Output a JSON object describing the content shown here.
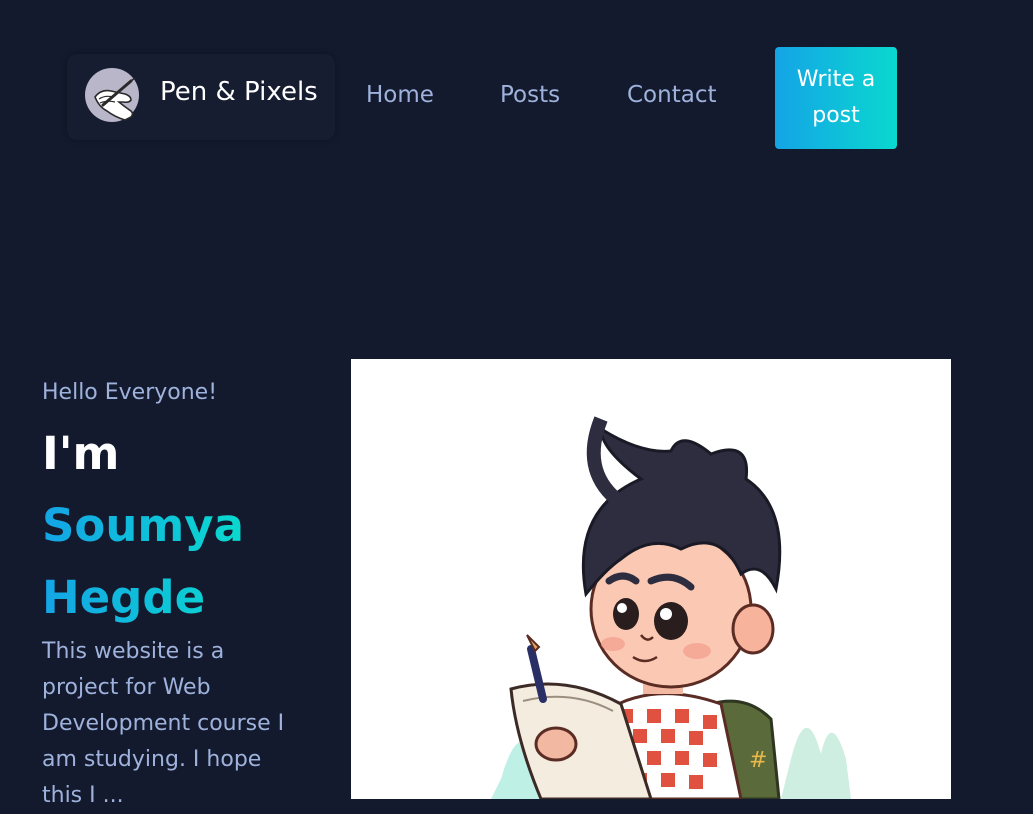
{
  "header": {
    "logo": {
      "icon": "hand-writing-icon",
      "text": "Pen & Pixels"
    },
    "nav": [
      {
        "label": "Home"
      },
      {
        "label": "Posts"
      },
      {
        "label": "Contact"
      }
    ],
    "cta_label": "Write a post"
  },
  "hero": {
    "greeting": "Hello Everyone!",
    "intro": "I'm",
    "name_line1": "Soumya",
    "name_line2": "Hegde",
    "description": "This website is a project for Web Development course I am studying. I hope this I ..."
  },
  "colors": {
    "background": "#131a2e",
    "nav_text": "#9fb2dc",
    "accent_start": "#14a4e6",
    "accent_end": "#0ad8cf"
  }
}
